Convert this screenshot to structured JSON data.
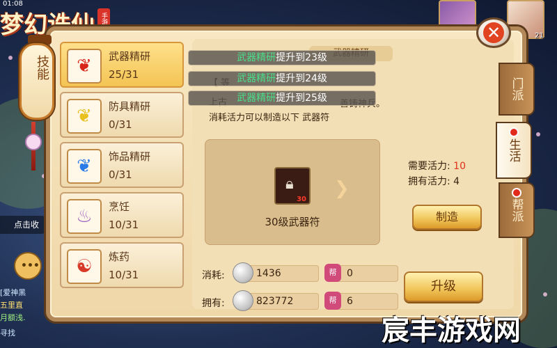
{
  "status": {
    "time": "01:08"
  },
  "game": {
    "logo_text": "梦幻诛仙",
    "logo_tag": "手游"
  },
  "avatars": {
    "level": "21"
  },
  "chat": {
    "collapse_label": "点击收",
    "lines": [
      "[爱神黑",
      "五里直",
      "月额浅.",
      "寻找"
    ]
  },
  "side_tab": {
    "skill_label": "技能"
  },
  "right_tabs": [
    {
      "label": "门派",
      "has_dot": false
    },
    {
      "label": "生活",
      "has_dot": true,
      "active": true
    },
    {
      "label": "帮派",
      "has_dot": true
    }
  ],
  "skills": [
    {
      "name": "武器精研",
      "level": "25/31",
      "icon": "weapon-icon",
      "active": true
    },
    {
      "name": "防具精研",
      "level": "0/31",
      "icon": "armor-icon"
    },
    {
      "name": "饰品精研",
      "level": "0/31",
      "icon": "accessory-icon"
    },
    {
      "name": "烹饪",
      "level": "10/31",
      "icon": "cooking-pot-icon"
    },
    {
      "name": "炼药",
      "level": "10/31",
      "icon": "alchemy-furnace-icon"
    }
  ],
  "tooltips": [
    {
      "highlight": "武器精研",
      "text": "提升到23级"
    },
    {
      "highlight": "武器精研",
      "text": "提升到24级"
    },
    {
      "highlight": "武器精研",
      "text": "提升到25级"
    }
  ],
  "detail": {
    "header_label": "武器精研",
    "desc_1": "【 等",
    "desc_2a": "上古",
    "desc_2b": "善铸神兵。",
    "desc_3": "消耗活力可以制造以下 武器符"
  },
  "craft": {
    "item_name": "30级武器符",
    "item_level": "30",
    "need_label": "需要活力:",
    "need_value": "10",
    "have_label": "拥有活力:",
    "have_value": "4",
    "craft_button": "制造"
  },
  "cost": {
    "consume_label": "消耗:",
    "own_label": "拥有:",
    "guild_icon_text": "帮",
    "consume_silver": "1436",
    "consume_guild": "0",
    "own_silver": "823772",
    "own_guild": "6",
    "upgrade_button": "升级"
  },
  "watermark": "宸丰游戏网",
  "colors": {
    "highlight_green": "#4ae08a",
    "warning_red": "#e0301a",
    "panel_bg": "#f3dfb6"
  }
}
